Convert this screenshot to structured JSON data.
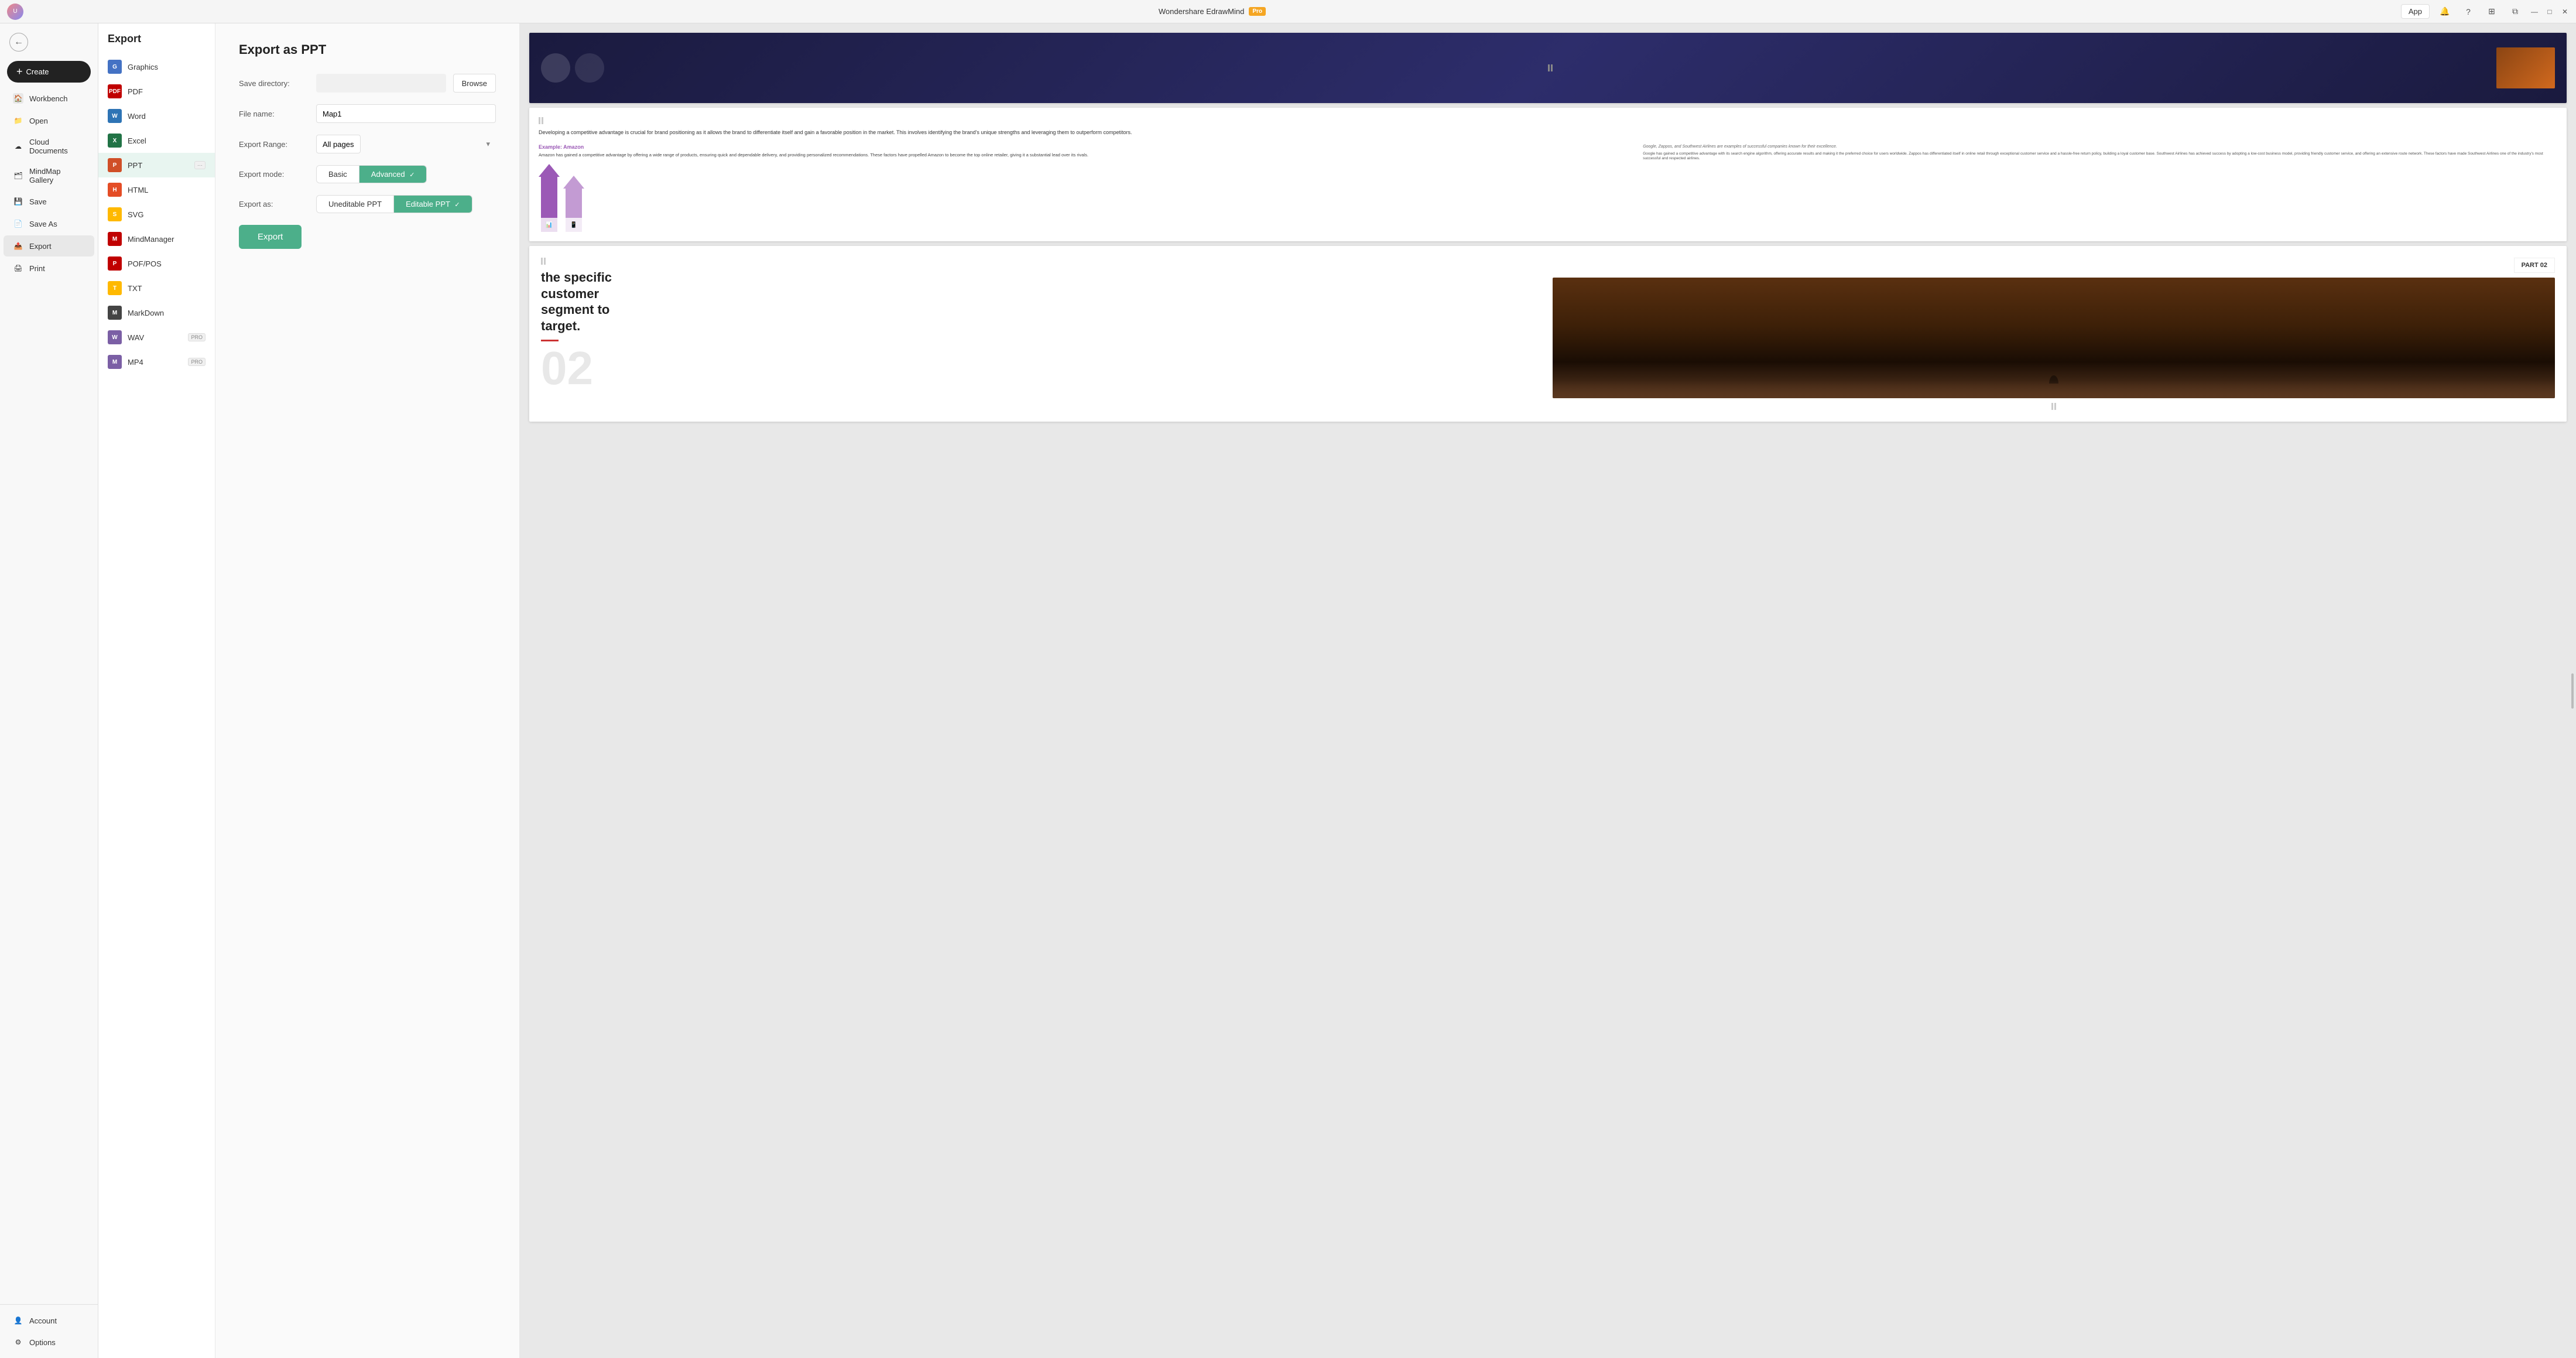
{
  "app": {
    "title": "Wondershare EdrawMind",
    "pro_badge": "Pro"
  },
  "titlebar": {
    "minimize": "—",
    "maximize": "□",
    "close": "✕",
    "app_button": "App",
    "avatar_initials": "U"
  },
  "sidebar": {
    "back_label": "←",
    "create_label": "Create",
    "items": [
      {
        "id": "workbench",
        "label": "Workbench",
        "icon": "🏠"
      },
      {
        "id": "open",
        "label": "Open",
        "icon": "📁"
      },
      {
        "id": "cloud",
        "label": "Cloud Documents",
        "icon": "☁"
      },
      {
        "id": "mindmap",
        "label": "MindMap Gallery",
        "icon": "🗂"
      },
      {
        "id": "save",
        "label": "Save",
        "icon": "💾"
      },
      {
        "id": "saveas",
        "label": "Save As",
        "icon": "📄"
      },
      {
        "id": "export",
        "label": "Export",
        "icon": "📤",
        "active": true
      },
      {
        "id": "print",
        "label": "Print",
        "icon": "🖨"
      }
    ],
    "bottom_items": [
      {
        "id": "account",
        "label": "Account",
        "icon": "👤"
      },
      {
        "id": "options",
        "label": "Options",
        "icon": "⚙"
      }
    ]
  },
  "file_sidebar": {
    "title": "Export",
    "items": [
      {
        "id": "graphics",
        "label": "Graphics",
        "icon_text": "G",
        "icon_class": "icon-graphics",
        "pro": false
      },
      {
        "id": "pdf",
        "label": "PDF",
        "icon_text": "P",
        "icon_class": "icon-pdf",
        "pro": false
      },
      {
        "id": "word",
        "label": "Word",
        "icon_text": "W",
        "icon_class": "icon-word",
        "pro": false
      },
      {
        "id": "excel",
        "label": "Excel",
        "icon_text": "X",
        "icon_class": "icon-excel",
        "pro": false
      },
      {
        "id": "ppt",
        "label": "PPT",
        "icon_text": "P",
        "icon_class": "icon-ppt",
        "pro": false,
        "active": true
      },
      {
        "id": "html",
        "label": "HTML",
        "icon_text": "H",
        "icon_class": "icon-html",
        "pro": false
      },
      {
        "id": "svg",
        "label": "SVG",
        "icon_text": "S",
        "icon_class": "icon-svg",
        "pro": false
      },
      {
        "id": "mindmanager",
        "label": "MindManager",
        "icon_text": "M",
        "icon_class": "icon-mindmanager",
        "pro": false
      },
      {
        "id": "pofpos",
        "label": "POF/POS",
        "icon_text": "P",
        "icon_class": "icon-pof",
        "pro": false
      },
      {
        "id": "txt",
        "label": "TXT",
        "icon_text": "T",
        "icon_class": "icon-txt",
        "pro": false
      },
      {
        "id": "markdown",
        "label": "MarkDown",
        "icon_text": "M",
        "icon_class": "icon-markdown",
        "pro": false
      },
      {
        "id": "wav",
        "label": "WAV",
        "icon_text": "W",
        "icon_class": "icon-wav",
        "pro": true
      },
      {
        "id": "mp4",
        "label": "MP4",
        "icon_text": "M",
        "icon_class": "icon-mp4",
        "pro": true
      }
    ]
  },
  "export_form": {
    "title": "Export as PPT",
    "save_directory_label": "Save directory:",
    "save_directory_value": "",
    "browse_label": "Browse",
    "file_name_label": "File name:",
    "file_name_value": "Map1",
    "export_range_label": "Export Range:",
    "export_range_value": "All pages",
    "export_mode_label": "Export mode:",
    "mode_basic": "Basic",
    "mode_advanced": "Advanced",
    "mode_active": "advanced",
    "export_as_label": "Export as:",
    "as_uneditable": "Uneditable PPT",
    "as_editable": "Editable PPT",
    "as_active": "editable",
    "export_button": "Export"
  },
  "preview": {
    "slide2_heading": "Developing a competitive advantage is crucial for brand positioning as it allows the brand to differentiate itself and gain a favorable position in the market. This involves identifying the brand's unique strengths and leveraging them to outperform competitors.",
    "slide2_amazon_label": "Example: Amazon",
    "slide2_amazon_text": "Amazon has gained a competitive advantage by offering a wide range of products, ensuring quick and dependable delivery, and providing personalized recommendations. These factors have propelled Amazon to become the top online retailer, giving it a substantial lead over its rivals.",
    "slide2_google_text": "Google, Zappos, and Southwest Airlines are examples of successful companies known for their excellence.",
    "slide2_google_body": "Google has gained a competitive advantage with its search engine algorithm, offering accurate results and making it the preferred choice for users worldwide. Zappos has differentiated itself in online retail through exceptional customer service and a hassle-free return policy, building a loyal customer base. Southwest Airlines has achieved success by adopting a low-cost business model, providing friendly customer service, and offering an extensive route network. These factors have made Southwest Airlines one of the industry's most successful and respected airlines.",
    "slide3_number": "02",
    "slide3_text_line1": "the specific",
    "slide3_text_line2": "customer",
    "slide3_text_line3": "segment to",
    "slide3_text_line4": "target.",
    "part_badge": "PART 02"
  }
}
